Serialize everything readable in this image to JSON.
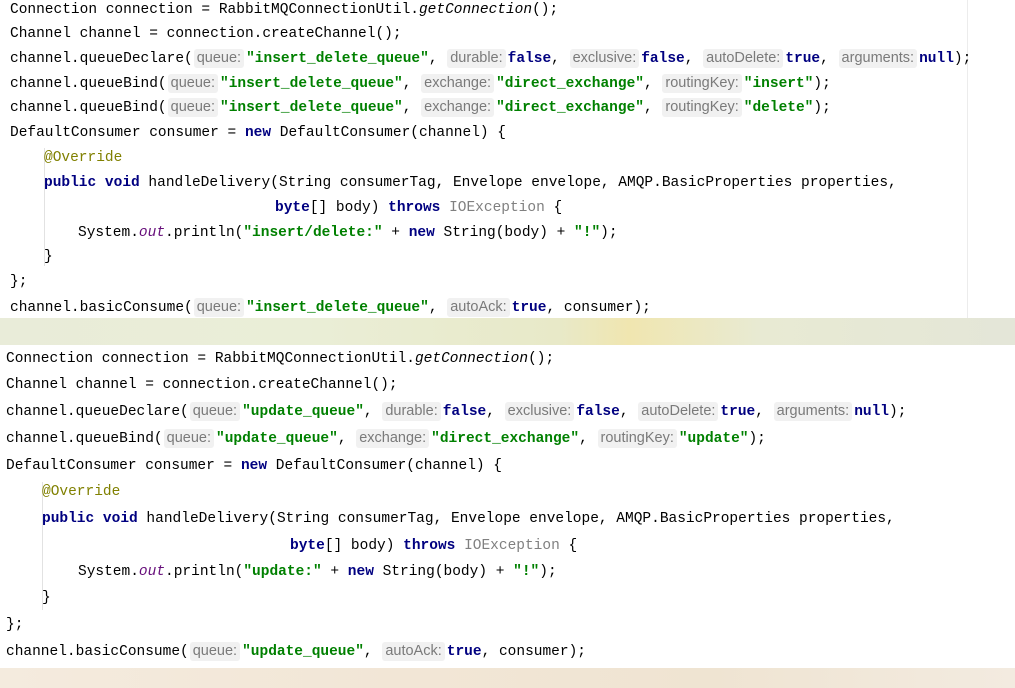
{
  "panels": [
    {
      "receiver": "Connection",
      "getConnection": "Connection connection = RabbitMQConnectionUtil.",
      "getConnectionMethod": "getConnection",
      "getConnectionTail": "();",
      "createChannel": "Channel channel = connection.createChannel();",
      "declare": {
        "prefix": "channel.queueDeclare(",
        "hint_queue": "queue:",
        "queue": "\"insert_delete_queue\"",
        "hint_durable": "durable:",
        "durable": "false",
        "hint_exclusive": "exclusive:",
        "exclusive": "false",
        "hint_autoDelete": "autoDelete:",
        "autoDelete": "true",
        "hint_arguments": "arguments:",
        "arguments": "null",
        "suffix": ");"
      },
      "binds": [
        {
          "prefix": "channel.queueBind(",
          "hint_queue": "queue:",
          "queue": "\"insert_delete_queue\"",
          "hint_exchange": "exchange:",
          "exchange": "\"direct_exchange\"",
          "hint_routingKey": "routingKey:",
          "routingKey": "\"insert\"",
          "suffix": ");"
        },
        {
          "prefix": "channel.queueBind(",
          "hint_queue": "queue:",
          "queue": "\"insert_delete_queue\"",
          "hint_exchange": "exchange:",
          "exchange": "\"direct_exchange\"",
          "hint_routingKey": "routingKey:",
          "routingKey": "\"delete\"",
          "suffix": ");"
        }
      ],
      "consumerDecl": {
        "a": "DefaultConsumer consumer = ",
        "new": "new",
        "b": " DefaultConsumer(channel) {"
      },
      "override": "@Override",
      "handle": {
        "public": "public",
        "void": "void",
        "sig": " handleDelivery(String consumerTag, Envelope envelope, AMQP.BasicProperties properties,"
      },
      "handle2": {
        "byte": "byte",
        "mid": "[] body) ",
        "throws": "throws",
        "exc": "IOException",
        "brace": " {"
      },
      "println": {
        "a": "System.",
        "out": "out",
        "b": ".println(",
        "str": "\"insert/delete:\"",
        "c": " + ",
        "new": "new",
        "d": " String(body) + ",
        "str2": "\"!\"",
        "e": ");"
      },
      "close1": "}",
      "close2": "};",
      "consume": {
        "prefix": "channel.basicConsume(",
        "hint_queue": "queue:",
        "queue": "\"insert_delete_queue\"",
        "hint_autoAck": "autoAck:",
        "autoAck": "true",
        "suffix": ", consumer);"
      }
    },
    {
      "getConnection": "Connection connection = RabbitMQConnectionUtil.",
      "getConnectionMethod": "getConnection",
      "getConnectionTail": "();",
      "createChannel": "Channel channel = connection.createChannel();",
      "declare": {
        "prefix": "channel.queueDeclare(",
        "hint_queue": "queue:",
        "queue": "\"update_queue\"",
        "hint_durable": "durable:",
        "durable": "false",
        "hint_exclusive": "exclusive:",
        "exclusive": "false",
        "hint_autoDelete": "autoDelete:",
        "autoDelete": "true",
        "hint_arguments": "arguments:",
        "arguments": "null",
        "suffix": ");"
      },
      "binds": [
        {
          "prefix": "channel.queueBind(",
          "hint_queue": "queue:",
          "queue": "\"update_queue\"",
          "hint_exchange": "exchange:",
          "exchange": "\"direct_exchange\"",
          "hint_routingKey": "routingKey:",
          "routingKey": "\"update\"",
          "suffix": ");"
        }
      ],
      "consumerDecl": {
        "a": "DefaultConsumer consumer = ",
        "new": "new",
        "b": " DefaultConsumer(channel) {"
      },
      "override": "@Override",
      "handle": {
        "public": "public",
        "void": "void",
        "sig": " handleDelivery(String consumerTag, Envelope envelope, AMQP.BasicProperties properties,"
      },
      "handle2": {
        "byte": "byte",
        "mid": "[] body) ",
        "throws": "throws",
        "exc": "IOException",
        "brace": " {"
      },
      "println": {
        "a": "System.",
        "out": "out",
        "b": ".println(",
        "str": "\"update:\"",
        "c": " + ",
        "new": "new",
        "d": " String(body) + ",
        "str2": "\"!\"",
        "e": ");"
      },
      "close1": "}",
      "close2": "};",
      "consume": {
        "prefix": "channel.basicConsume(",
        "hint_queue": "queue:",
        "queue": "\"update_queue\"",
        "hint_autoAck": "autoAck:",
        "autoAck": "true",
        "suffix": ", consumer);"
      }
    }
  ]
}
